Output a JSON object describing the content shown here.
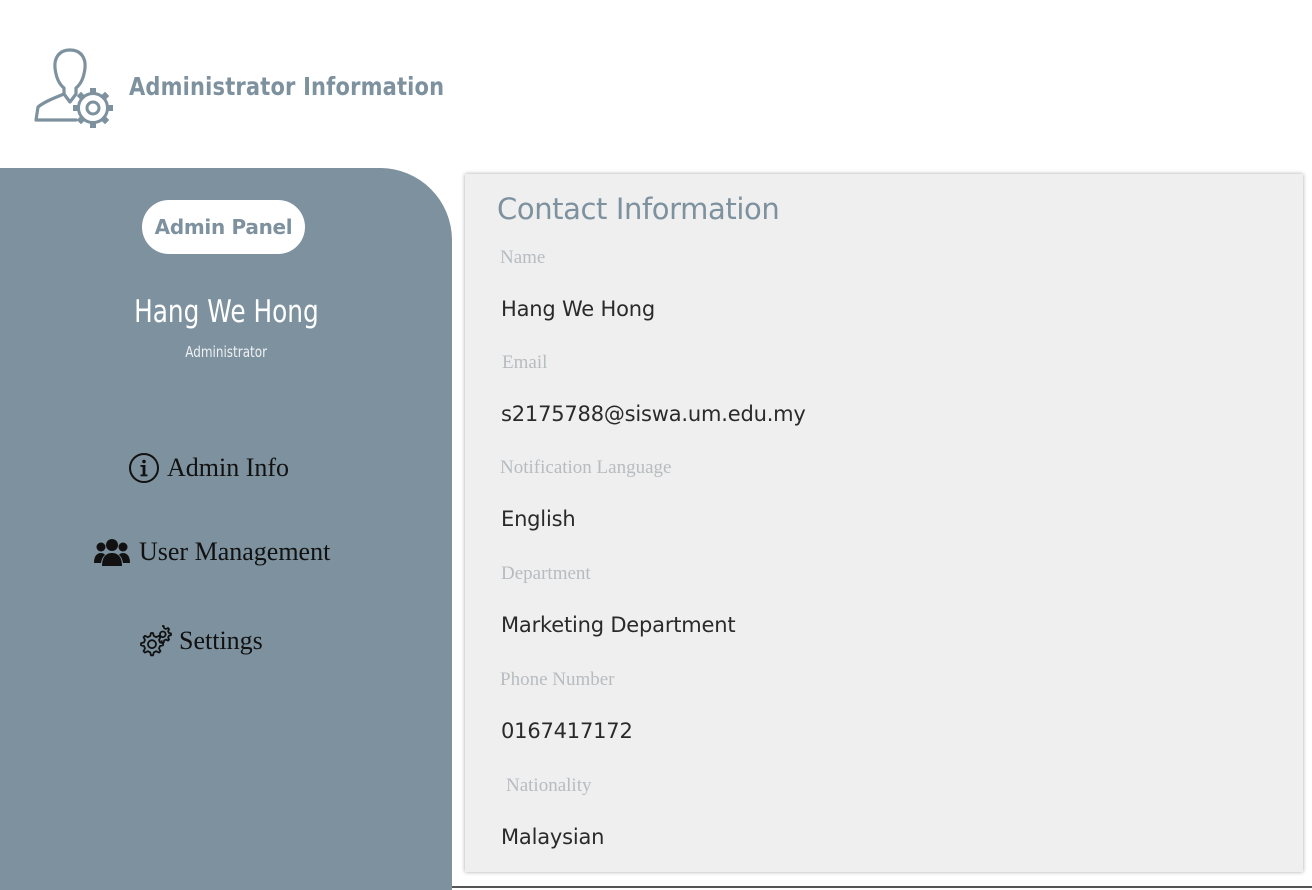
{
  "header": {
    "title": "Administrator Information",
    "icon": "admin-gear-icon"
  },
  "sidebar": {
    "panel_label": "Admin Panel",
    "user_name": "Hang We Hong",
    "user_role": "Administrator",
    "items": [
      {
        "label": "Admin Info",
        "icon": "info-icon"
      },
      {
        "label": "User Management",
        "icon": "users-icon"
      },
      {
        "label": "Settings",
        "icon": "gears-icon"
      }
    ]
  },
  "contact": {
    "title": "Contact Information",
    "fields": [
      {
        "label": "Name",
        "value": "Hang We Hong"
      },
      {
        "label": "Email",
        "value": "s2175788@siswa.um.edu.my"
      },
      {
        "label": "Notification Language",
        "value": "English"
      },
      {
        "label": "Department",
        "value": "Marketing Department"
      },
      {
        "label": "Phone Number",
        "value": "0167417172"
      },
      {
        "label": "Nationality",
        "value": "Malaysian"
      }
    ]
  },
  "colors": {
    "accent": "#7d919e",
    "card_background": "#efefef",
    "label": "#b7bcc0",
    "value": "#2a2a2a"
  }
}
